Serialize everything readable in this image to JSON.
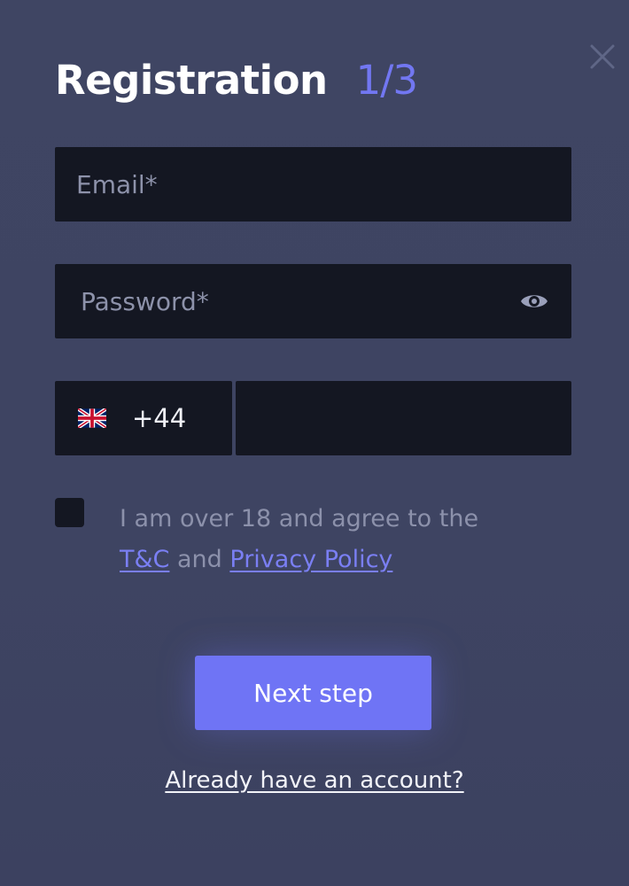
{
  "modal": {
    "title": "Registration",
    "step": "1/3"
  },
  "form": {
    "email_placeholder": "Email*",
    "password_placeholder": "Password*",
    "country_code": "+44",
    "phone_placeholder": "",
    "consent_prefix": "I am over 18 and agree to the",
    "terms_link": "T&C",
    "consent_and": "and",
    "privacy_link": "Privacy Policy",
    "next_button": "Next step",
    "login_link": "Already have an account?"
  },
  "icons": {
    "close": "close-icon",
    "eye": "eye-icon",
    "flag": "uk-flag-icon"
  },
  "colors": {
    "background": "#3e4463",
    "accent": "#6f74f5",
    "field": "#141722",
    "title": "#ffffff",
    "step": "#7277f2",
    "muted_text": "#8c91ab"
  }
}
